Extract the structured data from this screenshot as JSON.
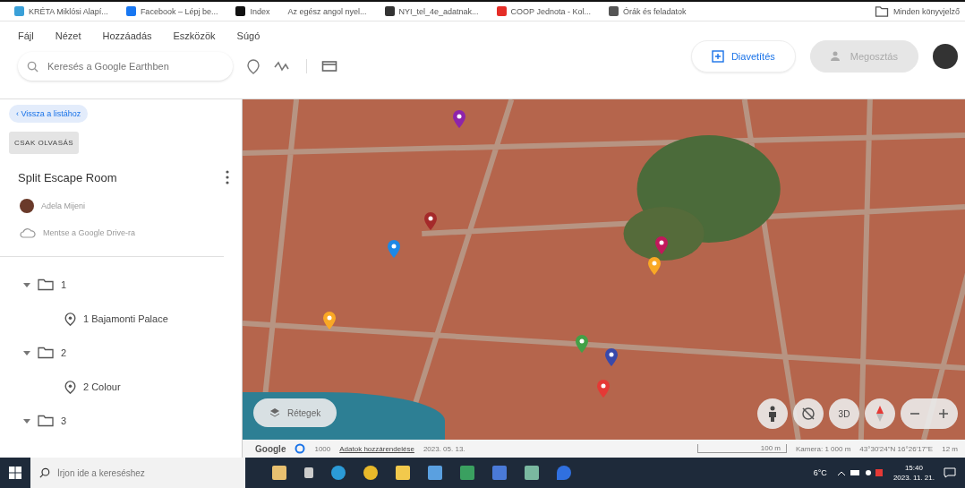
{
  "bookmarks": [
    {
      "label": "KRÉTA Miklósi Alapí...",
      "kind": "kreta"
    },
    {
      "label": "Facebook – Lépj be...",
      "kind": "facebook"
    },
    {
      "label": "Index",
      "kind": "index"
    },
    {
      "label": "Az egész angol nyel...",
      "kind": "none"
    },
    {
      "label": "NYI_tel_4e_adatnak...",
      "kind": "globe"
    },
    {
      "label": "COOP Jednota - Kol...",
      "kind": "youtube"
    },
    {
      "label": "Órák és feladatok",
      "kind": "k"
    }
  ],
  "all_bookmarks": "Minden könyvjelző",
  "menu": [
    "Fájl",
    "Nézet",
    "Hozzáadás",
    "Eszközök",
    "Súgó"
  ],
  "search": {
    "placeholder": "Keresés a Google Earthben"
  },
  "actions": [
    {
      "label": "Diavetítés",
      "disabled": false
    },
    {
      "label": "Megosztás",
      "disabled": true
    }
  ],
  "sidebar": {
    "back_link": "‹ Vissza a listához",
    "badge": "CSAK OLVASÁS",
    "title": "Split Escape Room",
    "author": "Adela Mijeni",
    "save_link": "Mentse a Google Drive-ra",
    "tree": [
      {
        "label": "1",
        "expanded": true,
        "children": [
          {
            "label": "1 Bajamonti Palace"
          }
        ]
      },
      {
        "label": "2",
        "expanded": true,
        "children": [
          {
            "label": "2 Colour"
          }
        ]
      },
      {
        "label": "3",
        "expanded": true
      }
    ]
  },
  "map": {
    "pins": [
      {
        "color": "#8e24aa"
      },
      {
        "color": "#a52a2a"
      },
      {
        "color": "#1e88e5"
      },
      {
        "color": "#c2185b"
      },
      {
        "color": "#f9a825"
      },
      {
        "color": "#f9a825"
      },
      {
        "color": "#43a047"
      },
      {
        "color": "#3949ab"
      },
      {
        "color": "#e53935"
      }
    ],
    "layers_button": "Rétegek",
    "view_3d": "3D"
  },
  "status_bar": {
    "logo": "Google",
    "count": "1000",
    "attribution": "Adatok hozzárendelése",
    "date": "2023. 05. 13.",
    "scale": "100 m",
    "camera": "Kamera: 1 000 m",
    "coordinates": "43°30'24\"N 16°26'17\"E",
    "elevation": "12 m"
  },
  "taskbar": {
    "search_placeholder": "Írjon ide a kereséshez",
    "temperature": "6°C",
    "time": "15:40",
    "date": "2023. 11. 21."
  }
}
